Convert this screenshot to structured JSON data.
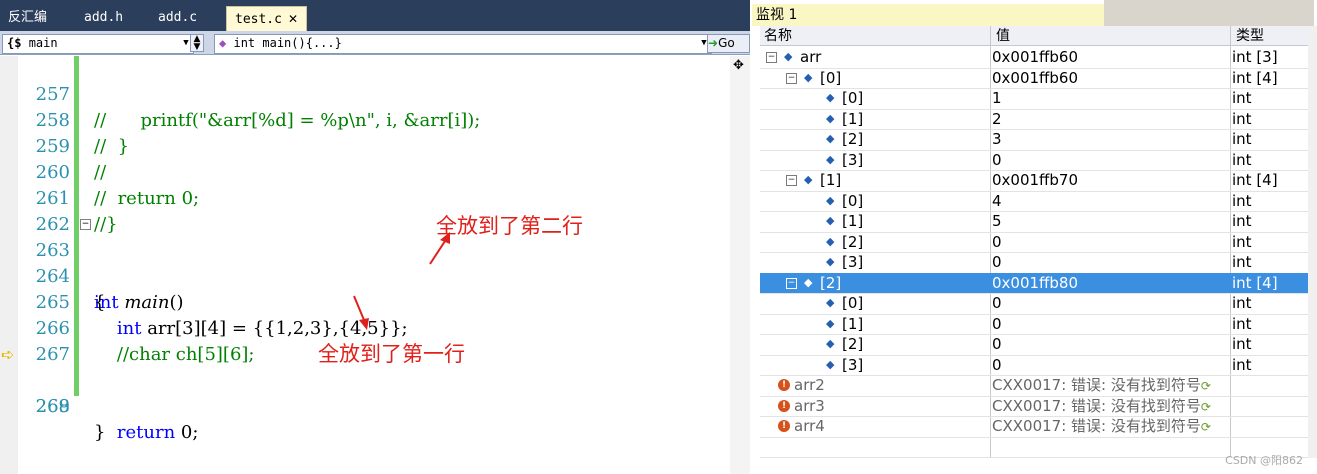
{
  "tabs": [
    {
      "label": "反汇编",
      "active": false
    },
    {
      "label": "add.h",
      "active": false
    },
    {
      "label": "add.c",
      "active": false
    },
    {
      "label": "test.c",
      "active": true
    }
  ],
  "nav": {
    "scope_label": "main",
    "function_label": "int main(){...}",
    "go_label": "Go"
  },
  "code_lines": [
    {
      "num": "257",
      "text": "//      printf(\"&arr[%d] = %p\\n\", i, &arr[i]);",
      "type": "comment"
    },
    {
      "num": "258",
      "text": "//  }",
      "type": "comment"
    },
    {
      "num": "259",
      "text": "//",
      "type": "comment"
    },
    {
      "num": "260",
      "text": "//  return 0;",
      "type": "comment"
    },
    {
      "num": "261",
      "text": "//}",
      "type": "comment"
    },
    {
      "num": "262",
      "text": "",
      "type": "plain"
    },
    {
      "num": "263",
      "kw": "int ",
      "fn": "main",
      "rest": "()",
      "type": "func"
    },
    {
      "num": "264",
      "text": "{",
      "type": "plain"
    },
    {
      "num": "265",
      "kw": "    int ",
      "rest": "arr[3][4] = {{1,2,3},{4,5}};",
      "type": "decl"
    },
    {
      "num": "266",
      "text": "    //char ch[5][6];",
      "type": "comment"
    },
    {
      "num": "267",
      "text": "",
      "type": "plain"
    },
    {
      "num": "268",
      "kw": "    return ",
      "rest": "0;",
      "type": "decl"
    },
    {
      "num": "269",
      "text": "}",
      "type": "plain"
    }
  ],
  "annotations": {
    "second_row": "全放到了第二行",
    "first_row": "全放到了第一行"
  },
  "watch": {
    "title": "监视 1",
    "columns": [
      "名称",
      "值",
      "类型"
    ],
    "rows": [
      {
        "name": "arr",
        "value": "0x001ffb60",
        "type": "int [3]",
        "level": 0,
        "toggle": "⊟"
      },
      {
        "name": "[0]",
        "value": "0x001ffb60",
        "type": "int [4]",
        "level": 1,
        "toggle": "⊟"
      },
      {
        "name": "[0]",
        "value": "1",
        "type": "int",
        "level": 2
      },
      {
        "name": "[1]",
        "value": "2",
        "type": "int",
        "level": 2
      },
      {
        "name": "[2]",
        "value": "3",
        "type": "int",
        "level": 2
      },
      {
        "name": "[3]",
        "value": "0",
        "type": "int",
        "level": 2
      },
      {
        "name": "[1]",
        "value": "0x001ffb70",
        "type": "int [4]",
        "level": 1,
        "toggle": "⊟"
      },
      {
        "name": "[0]",
        "value": "4",
        "type": "int",
        "level": 2
      },
      {
        "name": "[1]",
        "value": "5",
        "type": "int",
        "level": 2
      },
      {
        "name": "[2]",
        "value": "0",
        "type": "int",
        "level": 2
      },
      {
        "name": "[3]",
        "value": "0",
        "type": "int",
        "level": 2
      },
      {
        "name": "[2]",
        "value": "0x001ffb80",
        "type": "int [4]",
        "level": 1,
        "toggle": "⊟",
        "selected": true
      },
      {
        "name": "[0]",
        "value": "0",
        "type": "int",
        "level": 2
      },
      {
        "name": "[1]",
        "value": "0",
        "type": "int",
        "level": 2
      },
      {
        "name": "[2]",
        "value": "0",
        "type": "int",
        "level": 2
      },
      {
        "name": "[3]",
        "value": "0",
        "type": "int",
        "level": 2
      },
      {
        "name": "arr2",
        "value": "CXX0017: 错误: 没有找到符号",
        "type": "",
        "error": true
      },
      {
        "name": "arr3",
        "value": "CXX0017: 错误: 没有找到符号",
        "type": "",
        "error": true
      },
      {
        "name": "arr4",
        "value": "CXX0017: 错误: 没有找到符号",
        "type": "",
        "error": true
      }
    ]
  },
  "watermark": "CSDN @阳862"
}
